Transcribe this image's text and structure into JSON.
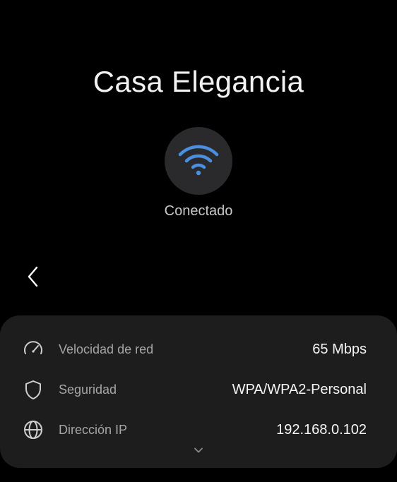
{
  "network": {
    "name": "Casa Elegancia",
    "status": "Conectado"
  },
  "icons": {
    "wifi": "wifi-icon",
    "back": "chevron-left-icon",
    "speed": "speedometer-icon",
    "security": "shield-icon",
    "ip": "globe-icon",
    "expand": "chevron-down-icon"
  },
  "colors": {
    "accent": "#4a8fe0",
    "card_background": "#1d1d1e",
    "icon_circle": "#2a2a2c"
  },
  "details": {
    "speed": {
      "label": "Velocidad de red",
      "value": "65 Mbps"
    },
    "security": {
      "label": "Seguridad",
      "value": "WPA/WPA2-Personal"
    },
    "ip": {
      "label": "Dirección IP",
      "value": "192.168.0.102"
    }
  }
}
